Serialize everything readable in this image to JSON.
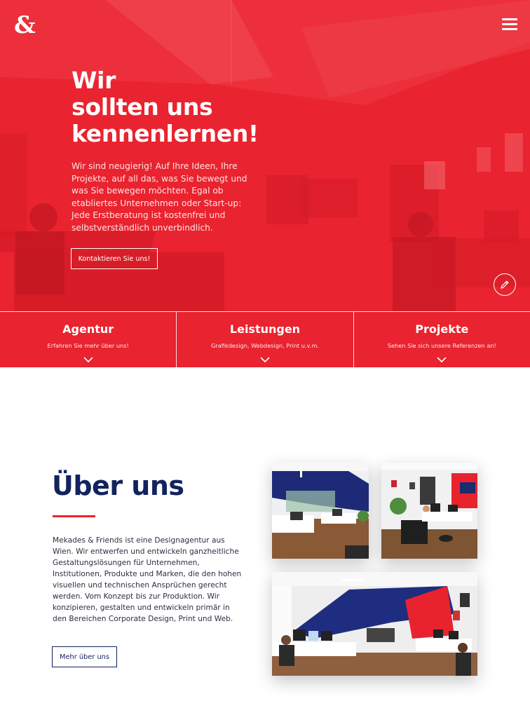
{
  "header": {
    "logo_icon": "ampersand-logo-icon",
    "menu_icon": "hamburger-menu-icon"
  },
  "hero": {
    "title_line1": "Wir",
    "title_line2": "sollten uns",
    "title_line3": "kennenlernen!",
    "text": "Wir sind neugierig! Auf Ihre Ideen, Ihre Projekte, auf all das, was Sie bewegt und was Sie bewegen möchten. Egal ob etabliertes Unternehmen oder Start-up: Jede Erstberatung ist kostenfrei und selbstverständlich unverbindlich.",
    "cta_label": "Kontaktieren Sie uns!",
    "edit_icon": "pencil-icon",
    "brand_color": "#e9232f"
  },
  "tiles": [
    {
      "title": "Agentur",
      "subtitle": "Erfahren Sie mehr über uns!",
      "icon": "chevron-down-icon"
    },
    {
      "title": "Leistungen",
      "subtitle": "Grafikdesign, Webdesign, Print u.v.m.",
      "icon": "chevron-down-icon"
    },
    {
      "title": "Projekte",
      "subtitle": "Sehen Sie sich unsere Referenzen an!",
      "icon": "chevron-down-icon"
    }
  ],
  "about": {
    "title": "Über uns",
    "text": "Mekades & Friends ist eine Designagentur aus Wien. Wir entwerfen und entwickeln ganzheitliche Gestaltungslösungen für Unternehmen, Institutionen, Produkte und Marken, die den hohen visuellen und technischen Ansprüchen gerecht werden. Vom Konzept bis zur Produktion. Wir konzipieren, gestalten und entwickeln primär in den Bereichen Corporate Design, Print und Web.",
    "button_label": "Mehr über uns",
    "title_color": "#12235e",
    "accent_color": "#e9232f"
  }
}
